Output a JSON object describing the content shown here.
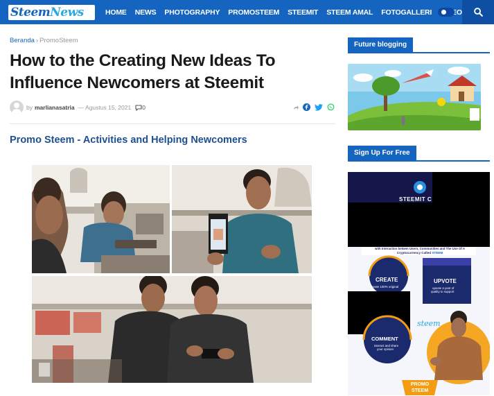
{
  "site": {
    "logo_part1": "Steem",
    "logo_part2": "News"
  },
  "nav": {
    "items": [
      "HOME",
      "NEWS",
      "PHOTOGRAPHY",
      "PROMOSTEEM",
      "STEEMIT",
      "STEEM AMAL",
      "FOTOGALLERI",
      "VIDEO"
    ]
  },
  "breadcrumb": {
    "home": "Beranda",
    "separator": "›",
    "current": "PromoSteem"
  },
  "article": {
    "title": "How to the Creating New Ideas To Influence Newcomers at Steemit",
    "by": "by",
    "author": "marlianasatria",
    "date": "— Agustus 15, 2021",
    "comment_count": "0",
    "subheading": "Promo Steem - Activities and Helping Newcomers"
  },
  "sidebar": {
    "widget1_title": "Future blogging",
    "widget2_title": "Sign Up For Free",
    "poster": {
      "brand": "STEEMIT C",
      "tagline_line1": "with Interaction betwen Users, Communities and The Use Of A",
      "tagline_line2": "Cryptocurrency Called",
      "tagline_steem": "STEEM",
      "create_title": "CREATE",
      "create_sub": "create 100% original",
      "upvote_title": "UPVOTE",
      "upvote_sub1": "upvote a post of",
      "upvote_sub2": "quality to support",
      "comment_title": "COMMENT",
      "comment_sub1": "interact and share",
      "comment_sub2": "your opinion",
      "script": "steem",
      "promo_line1": "PROMO",
      "promo_line2": "STEEM"
    }
  },
  "colors": {
    "brand_blue": "#1565c0",
    "subheading_blue": "#1e4f8f",
    "whatsapp_green": "#25d366",
    "promo_orange": "#f39c12"
  },
  "icons": {
    "search": "search-icon",
    "theme_toggle": "theme-toggle-icon",
    "comment": "comment-icon",
    "share": "share-icon",
    "facebook": "facebook-icon",
    "twitter": "twitter-icon",
    "whatsapp": "whatsapp-icon"
  }
}
